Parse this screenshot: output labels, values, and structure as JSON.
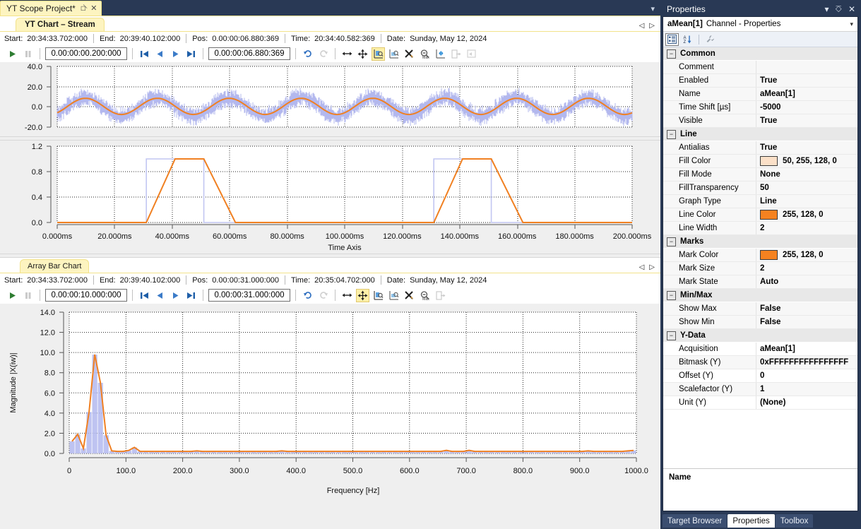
{
  "window": {
    "tab_title": "YT Scope Project*",
    "pin_icon": "pin-icon",
    "close_icon": "close-icon"
  },
  "charts": [
    {
      "tab_label": "YT Chart – Stream",
      "info": {
        "start_label": "Start:",
        "start_value": "20:34:33.702:000",
        "end_label": "End:",
        "end_value": "20:39:40.102:000",
        "pos_label": "Pos:",
        "pos_value": "0.00:00:06.880:369",
        "time_label": "Time:",
        "time_value": "20:34:40.582:369",
        "date_label": "Date:",
        "date_value": "Sunday, May 12, 2024"
      },
      "toolbar": {
        "step_field": "0.00:00:00.200:000",
        "pos_field": "0.00:00:06.880:369"
      }
    },
    {
      "tab_label": "Array Bar Chart",
      "info": {
        "start_label": "Start:",
        "start_value": "20:34:33.702:000",
        "end_label": "End:",
        "end_value": "20:39:40.102:000",
        "pos_label": "Pos:",
        "pos_value": "0.00:00:31.000:000",
        "time_label": "Time:",
        "time_value": "20:35:04.702:000",
        "date_label": "Date:",
        "date_value": "Sunday, May 12, 2024"
      },
      "toolbar": {
        "step_field": "0.00:00:10.000:000",
        "pos_field": "0.00:00:31.000:000"
      }
    }
  ],
  "chart_data": [
    {
      "type": "line",
      "name": "yt-chart-top",
      "title": "",
      "xlabel": "",
      "ylabel": "",
      "ylim": [
        -20.0,
        40.0
      ],
      "xlim": [
        0,
        200
      ],
      "yticks": [
        "40.0",
        "20.0",
        "0.0",
        "-20.0"
      ],
      "ytick_values": [
        40.0,
        20.0,
        0.0,
        -20.0
      ],
      "grid": true,
      "series": [
        {
          "name": "raw-noisy",
          "color": "#b3b8ee",
          "kind": "noise-band",
          "description": "noisy sine, 8 cycles over 200 ms, amplitude ~10, noise band +/-7",
          "amplitude": 9,
          "cycles": 8,
          "offset": 0,
          "noise": 7
        },
        {
          "name": "aMean[1]",
          "color": "#f08022",
          "kind": "sine",
          "description": "smoothed mean sine, 8 cycles over 200 ms, amplitude ~8",
          "amplitude": 8,
          "cycles": 8,
          "offset": 0.5
        }
      ]
    },
    {
      "type": "line",
      "name": "yt-chart-middle",
      "title": "",
      "xlabel": "Time Axis",
      "ylabel": "",
      "ylim": [
        0.0,
        1.2
      ],
      "xlim": [
        0,
        200
      ],
      "yticks": [
        "1.2",
        "0.8",
        "0.4",
        "0.0"
      ],
      "ytick_values": [
        1.2,
        0.8,
        0.4,
        0.0
      ],
      "xticks": [
        "0.000ms",
        "20.000ms",
        "40.000ms",
        "60.000ms",
        "80.000ms",
        "100.000ms",
        "120.000ms",
        "140.000ms",
        "160.000ms",
        "180.000ms",
        "200.000ms"
      ],
      "xtick_values": [
        0,
        20,
        40,
        60,
        80,
        100,
        120,
        140,
        160,
        180,
        200
      ],
      "grid": true,
      "series": [
        {
          "name": "square-digital",
          "color": "#c2c6f2",
          "kind": "square",
          "description": "square pulses high from 31-51 ms and from 131-151 ms, level 1.0",
          "pulses": [
            [
              31,
              51
            ],
            [
              131,
              151
            ]
          ],
          "high": 1.0,
          "low": 0.0
        },
        {
          "name": "filtered-trapezoid",
          "color": "#f08022",
          "kind": "trapezoid",
          "description": "slew-limited version: ramps up 31-41 ms, holds 41-51 ms, ramps down 51-62 ms; repeats at 131-162 ms",
          "points": [
            [
              0,
              0
            ],
            [
              31,
              0
            ],
            [
              41,
              1.0
            ],
            [
              51,
              1.0
            ],
            [
              62,
              0
            ],
            [
              131,
              0
            ],
            [
              141,
              1.0
            ],
            [
              151,
              1.0
            ],
            [
              162,
              0
            ],
            [
              200,
              0
            ]
          ],
          "high": 1.0,
          "low": 0.0
        }
      ]
    },
    {
      "type": "bar",
      "name": "array-bar-chart",
      "title": "",
      "xlabel": "Frequency [Hz]",
      "ylabel": "Magnitude |X(iw)|",
      "ylim": [
        0.0,
        14.0
      ],
      "xlim": [
        0,
        1000
      ],
      "yticks": [
        "14.0",
        "12.0",
        "10.0",
        "8.0",
        "6.0",
        "4.0",
        "2.0",
        "0.0"
      ],
      "ytick_values": [
        14.0,
        12.0,
        10.0,
        8.0,
        6.0,
        4.0,
        2.0,
        0.0
      ],
      "xticks": [
        "0",
        "100.0",
        "200.0",
        "300.0",
        "400.0",
        "500.0",
        "600.0",
        "700.0",
        "800.0",
        "900.0",
        "1000.0"
      ],
      "xtick_values": [
        0,
        100,
        200,
        300,
        400,
        500,
        600,
        700,
        800,
        900,
        1000
      ],
      "grid": true,
      "bar_color": "#b3b8ee",
      "line_color": "#f08022",
      "bin_width": 10,
      "categories": [
        0,
        10,
        20,
        30,
        40,
        50,
        60,
        70,
        80,
        90,
        100,
        110,
        120,
        130,
        140,
        150,
        160,
        170,
        180,
        190,
        200,
        210,
        220,
        230,
        240,
        250,
        260,
        270,
        280,
        290,
        300,
        310,
        320,
        330,
        340,
        350,
        360,
        370,
        380,
        390,
        400,
        410,
        420,
        430,
        440,
        450,
        460,
        470,
        480,
        490,
        500,
        510,
        520,
        530,
        540,
        550,
        560,
        570,
        580,
        590,
        600,
        610,
        620,
        630,
        640,
        650,
        660,
        670,
        680,
        690,
        700,
        710,
        720,
        730,
        740,
        750,
        760,
        770,
        780,
        790,
        800,
        810,
        820,
        830,
        840,
        850,
        860,
        870,
        880,
        890,
        900,
        910,
        920,
        930,
        940,
        950,
        960,
        970,
        980,
        990
      ],
      "values": [
        1.2,
        1.9,
        0.5,
        4.1,
        9.8,
        7.0,
        1.8,
        0.25,
        0.2,
        0.2,
        0.3,
        0.6,
        0.2,
        0.2,
        0.2,
        0.2,
        0.2,
        0.2,
        0.2,
        0.2,
        0.2,
        0.2,
        0.25,
        0.2,
        0.2,
        0.2,
        0.2,
        0.2,
        0.2,
        0.2,
        0.2,
        0.2,
        0.2,
        0.2,
        0.2,
        0.2,
        0.2,
        0.25,
        0.2,
        0.2,
        0.2,
        0.2,
        0.2,
        0.2,
        0.2,
        0.2,
        0.2,
        0.2,
        0.2,
        0.2,
        0.2,
        0.2,
        0.2,
        0.2,
        0.2,
        0.2,
        0.2,
        0.2,
        0.2,
        0.2,
        0.2,
        0.2,
        0.2,
        0.2,
        0.2,
        0.2,
        0.3,
        0.2,
        0.2,
        0.2,
        0.3,
        0.2,
        0.2,
        0.2,
        0.2,
        0.2,
        0.2,
        0.2,
        0.2,
        0.2,
        0.2,
        0.2,
        0.2,
        0.2,
        0.2,
        0.2,
        0.2,
        0.2,
        0.2,
        0.2,
        0.2,
        0.25,
        0.2,
        0.2,
        0.2,
        0.2,
        0.2,
        0.2,
        0.25,
        0.3
      ]
    }
  ],
  "properties": {
    "panel_title": "Properties",
    "header_strong": "aMean[1]",
    "header_rest": "Channel - Properties",
    "description_label": "Name",
    "toolbar_icons": [
      "categorized-icon",
      "alphabetical-icon",
      "property-pages-icon"
    ],
    "groups": [
      {
        "name": "Common",
        "rows": [
          {
            "name": "Comment",
            "value": ""
          },
          {
            "name": "Enabled",
            "value": "True"
          },
          {
            "name": "Name",
            "value": "aMean[1]"
          },
          {
            "name": "Time Shift [µs]",
            "value": "-5000"
          },
          {
            "name": "Visible",
            "value": "True"
          }
        ]
      },
      {
        "name": "Line",
        "rows": [
          {
            "name": "Antialias",
            "value": "True"
          },
          {
            "name": "Fill Color",
            "value": "50, 255, 128, 0",
            "swatch": "#fbe0c8"
          },
          {
            "name": "Fill Mode",
            "value": "None"
          },
          {
            "name": "FillTransparency",
            "value": "50"
          },
          {
            "name": "Graph Type",
            "value": "Line"
          },
          {
            "name": "Line Color",
            "value": "255, 128, 0",
            "swatch": "#f58220"
          },
          {
            "name": "Line Width",
            "value": "2"
          }
        ]
      },
      {
        "name": "Marks",
        "rows": [
          {
            "name": "Mark Color",
            "value": "255, 128, 0",
            "swatch": "#f58220"
          },
          {
            "name": "Mark Size",
            "value": "2"
          },
          {
            "name": "Mark State",
            "value": "Auto"
          }
        ]
      },
      {
        "name": "Min/Max",
        "rows": [
          {
            "name": "Show Max",
            "value": "False"
          },
          {
            "name": "Show Min",
            "value": "False"
          }
        ]
      },
      {
        "name": "Y-Data",
        "rows": [
          {
            "name": "Acquisition",
            "value": "aMean[1]"
          },
          {
            "name": "Bitmask (Y)",
            "value": "0xFFFFFFFFFFFFFFFF"
          },
          {
            "name": "Offset (Y)",
            "value": "0"
          },
          {
            "name": "Scalefactor (Y)",
            "value": "1"
          },
          {
            "name": "Unit (Y)",
            "value": "(None)"
          }
        ]
      }
    ],
    "tabs": [
      {
        "label": "Target Browser",
        "active": false
      },
      {
        "label": "Properties",
        "active": true
      },
      {
        "label": "Toolbox",
        "active": false
      }
    ]
  },
  "colors": {
    "accent_orange": "#f08022",
    "raw_lavender": "#b3b8ee",
    "chrome_navy": "#293955",
    "tab_yellow": "#fdf4c0"
  }
}
